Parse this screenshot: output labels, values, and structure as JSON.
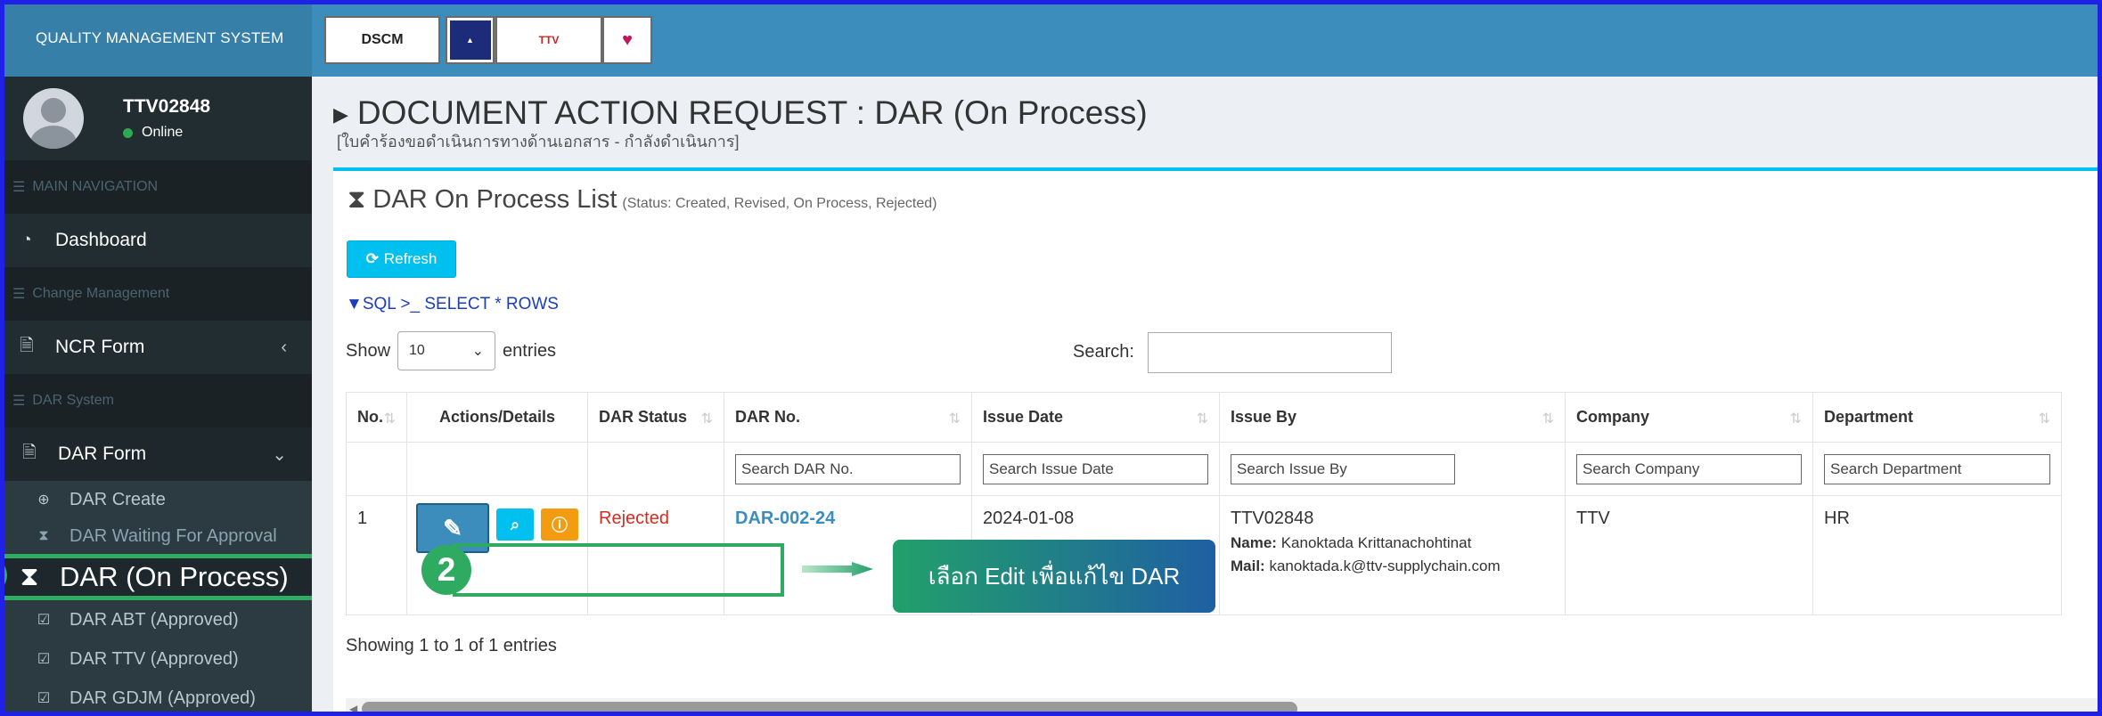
{
  "sidebar": {
    "brand": "QUALITY MANAGEMENT SYSTEM",
    "user_name": "TTV02848",
    "user_status": "Online",
    "main_nav_header": "MAIN NAVIGATION",
    "dashboard": "Dashboard",
    "change_header": "Change Management",
    "ncr_form": "NCR Form",
    "dar_header": "DAR System",
    "dar_form": "DAR Form",
    "items": [
      {
        "label": "DAR Create",
        "icon": "plus-circle-icon"
      },
      {
        "label": "DAR Waiting For Approval",
        "icon": "hourglass-icon"
      },
      {
        "label": "DAR (On Process)",
        "icon": "hourglass-icon"
      },
      {
        "label": "DAR ABT (Approved)",
        "icon": "check-square-icon"
      },
      {
        "label": "DAR TTV (Approved)",
        "icon": "check-square-icon"
      },
      {
        "label": "DAR GDJM (Approved)",
        "icon": "check-square-icon"
      }
    ]
  },
  "topnav": {
    "logos": [
      "DSCM",
      "TTV"
    ]
  },
  "page": {
    "title": "DOCUMENT ACTION REQUEST : DAR (On Process)",
    "subtitle": "[ใบคำร้องขอดำเนินการทางด้านเอกสาร - กำลังดำเนินการ]"
  },
  "box": {
    "title": "DAR On Process List",
    "status_note": "(Status: Created, Revised, On Process, Rejected)",
    "refresh": "Refresh",
    "sql": "SQL >_ SELECT * ROWS",
    "show": "Show",
    "entries_value": "10",
    "entries": "entries",
    "search_label": "Search:",
    "showing": "Showing 1 to 1 of 1 entries"
  },
  "table": {
    "headers": [
      "No.",
      "Actions/Details",
      "DAR Status",
      "DAR No.",
      "Issue Date",
      "Issue By",
      "Company",
      "Department"
    ],
    "filters": [
      "Search DAR No.",
      "Search Issue Date",
      "Search Issue By",
      "Search Company",
      "Search Department"
    ],
    "row": {
      "no": "1",
      "status": "Rejected",
      "dar_no": "DAR-002-24",
      "issue_date": "2024-01-08",
      "issue_by": "TTV02848",
      "name_label": "Name:",
      "name": "Kanoktada Krittanachohtinat",
      "mail_label": "Mail:",
      "mail": "kanoktada.k@ttv-supplychain.com",
      "company": "TTV",
      "department": "HR"
    }
  },
  "annotation": {
    "step": "2",
    "callout": "เลือก Edit เพื่อแก้ไข DAR",
    "color": "#2eaa61"
  }
}
